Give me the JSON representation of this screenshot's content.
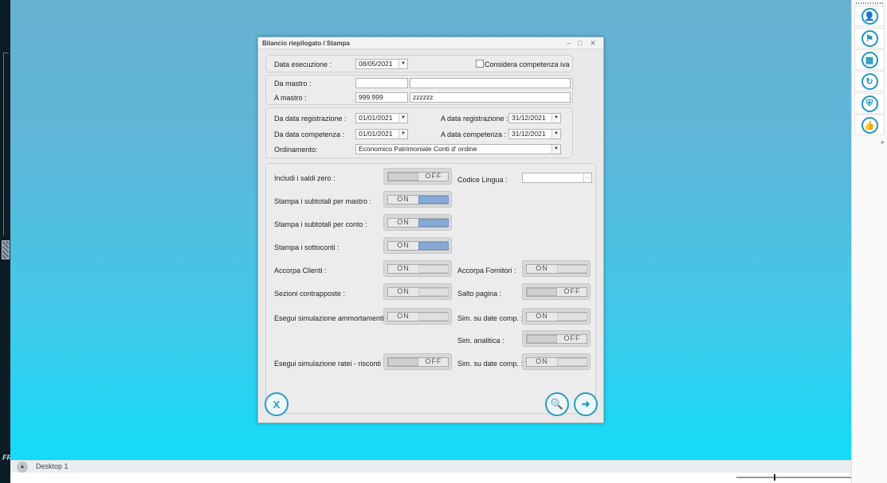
{
  "dialog": {
    "title": "Bilancio riepilogato / Stampa",
    "controls": {
      "minimize": "–",
      "maximize": "□",
      "close": "✕"
    }
  },
  "exec": {
    "date_label": "Data esecuzione :",
    "date_value": "08/05/2021",
    "iva_label": "Considera competenza iva",
    "iva_checked": false
  },
  "mastro": {
    "from_label": "Da mastro :",
    "from_code": "",
    "from_desc": "",
    "to_label": "A mastro :",
    "to_code": "999.999",
    "to_desc": "zzzzzz"
  },
  "dates": {
    "reg_from_label": "Da data registrazione :",
    "reg_from_value": "01/01/2021",
    "reg_to_label": "A data registrazione :",
    "reg_to_value": "31/12/2021",
    "comp_from_label": "Da data competenza :",
    "comp_from_value": "01/01/2021",
    "comp_to_label": "A data competenza :",
    "comp_to_value": "31/12/2021",
    "order_label": "Ordinamento:",
    "order_value": "Economico Patrimoniale Conti d' ordine"
  },
  "options": {
    "saldi_zero_label": "Includi i saldi zero :",
    "saldi_zero": "OFF",
    "lingua_label": "Codice Lingua :",
    "lingua_value": "",
    "sub_mastro_label": "Stampa i subtotali per mastro :",
    "sub_mastro": "ON",
    "sub_conto_label": "Stampa i subtotali per conto :",
    "sub_conto": "ON",
    "sottoconti_label": "Stampa i sottoconti :",
    "sottoconti": "ON",
    "clienti_label": "Accorpa Clienti :",
    "clienti": "ON",
    "fornitori_label": "Accorpa Fornitori :",
    "fornitori": "ON",
    "sezioni_label": "Sezioni contrapposte :",
    "sezioni": "ON",
    "salto_label": "Salto pagina :",
    "salto": "OFF",
    "ammort_label": "Esegui simulazione ammortamenti :",
    "ammort": "ON",
    "sim_date1_label": "Sim. su date comp. :",
    "sim_date1": "ON",
    "analitica_label": "Sim. analitica :",
    "analitica": "OFF",
    "ratei_label": "Esegui simulazione ratei - risconti :",
    "ratei": "OFF",
    "sim_date2_label": "Sim. su date comp. :",
    "sim_date2": "ON"
  },
  "buttons": {
    "cancel_icon": "excel-x-icon",
    "preview_icon": "print-preview-icon",
    "exit_icon": "exit-door-icon"
  },
  "taskbar": {
    "desktop_label": "Desktop 1"
  },
  "left": {
    "fr_label": "FR"
  },
  "right_panel": {
    "icons": [
      "user-icon",
      "flag-icon",
      "grid-icon",
      "refresh-icon",
      "shield-icon",
      "thumbs-up-icon"
    ]
  },
  "colors": {
    "accent": "#2a9bc3",
    "toggle_on": "#86a9d6",
    "desktop_top": "#67b1d0",
    "desktop_bottom": "#12dcf7"
  }
}
